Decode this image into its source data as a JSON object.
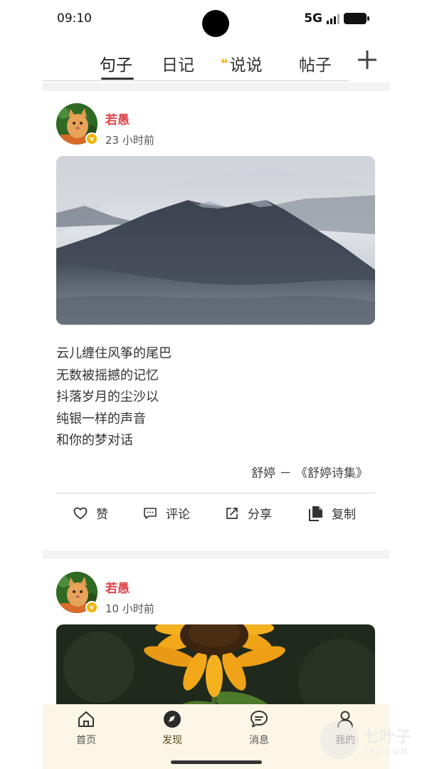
{
  "status_bar": {
    "time": "09:10",
    "network": "5G"
  },
  "tabs": [
    {
      "label": "句子",
      "active": true
    },
    {
      "label": "日记",
      "active": false
    },
    {
      "label": "说说",
      "active": false,
      "icon": "quote-icon"
    },
    {
      "label": "帖子",
      "active": false
    }
  ],
  "add_button": {
    "icon": "plus-icon"
  },
  "posts": [
    {
      "username": "若愚",
      "time": "23 小时前",
      "image": "misty-mountain-photo",
      "lines": [
        "云儿缠住风筝的尾巴",
        "无数被摇撼的记忆",
        "抖落岁月的尘沙以",
        "纯银一样的声音",
        "和你的梦对话"
      ],
      "source": "舒婷 － 《舒婷诗集》",
      "actions": {
        "like": "赞",
        "comment": "评论",
        "share": "分享",
        "copy": "复制"
      }
    },
    {
      "username": "若愚",
      "time": "10 小时前",
      "image": "sunflower-photo"
    }
  ],
  "bottom_nav": [
    {
      "label": "首页",
      "icon": "home-icon",
      "active": false
    },
    {
      "label": "发现",
      "icon": "compass-icon",
      "active": true
    },
    {
      "label": "消息",
      "icon": "message-icon",
      "active": false
    },
    {
      "label": "我的",
      "icon": "person-icon",
      "active": false
    }
  ],
  "watermark": {
    "main": "七叶子",
    "sub": "7YZ.COM"
  },
  "colors": {
    "username": "#e0464c",
    "badge": "#f4b400",
    "quote_accent": "#f2b21a",
    "nav_bg": "#fcf6e6"
  }
}
